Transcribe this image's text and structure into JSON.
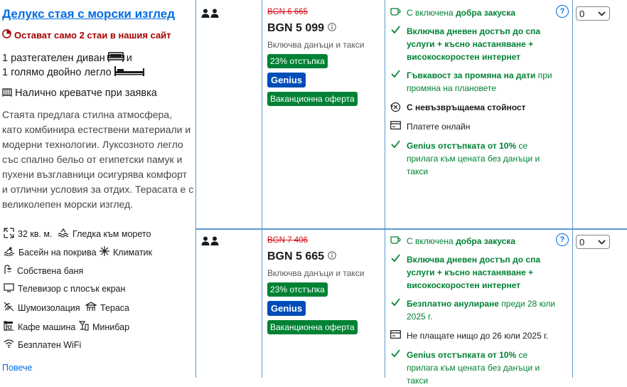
{
  "room": {
    "title": "Делукс стая с морски изглед",
    "scarcity": "Остават само 2 стаи в нашия сайт",
    "beds": [
      {
        "text": "1 разтегателен диван",
        "suffix": "и"
      },
      {
        "text": "1 голямо двойно легло",
        "suffix": ""
      }
    ],
    "crib": "Налично креватче при заявка",
    "description": "Стаята предлага стилна атмосфера, като комбинира естествени материали и модерни технологии. Луксозното легло със спално бельо от египетски памук и пухени възглавници осигурява комфорт и отлични условия за отдих. Терасата е с великолепен морски изглед.",
    "features": {
      "size": "32 кв. м.",
      "sea_view": "Гледка към морето",
      "rooftop_pool": "Басейн на покрива",
      "aircon": "Климатик",
      "bathroom": "Собствена баня",
      "tv": "Телевизор с плосък екран",
      "soundproof": "Шумоизолация",
      "terrace": "Тераса",
      "coffee": "Кафе машина",
      "minibar": "Минибар",
      "wifi": "Безплатен WiFi"
    },
    "more_link": "Повече"
  },
  "offers": [
    {
      "old_price": "BGN 6 665",
      "price": "BGN 5 099",
      "tax_note": "Включва данъци и такси",
      "discount": "23% отстъпка",
      "genius": "Genius",
      "vacation": "Ваканционна оферта",
      "breakfast_prefix": "С включена ",
      "breakfast_bold": "добра закуска",
      "day_access": "Включва дневен достъп до спа услуги + късно настаняване + високоскоростен интернет",
      "flex_bold": "Гъвкавост за промяна на дати",
      "flex_rest": " при промяна на плановете",
      "nonrefund": "С невъзвръщаема стойност",
      "pay": "Платете онлайн",
      "genius_bold": "Genius отстъпката от 10%",
      "genius_rest": " се прилага към цената без данъци и такси",
      "select_value": "0"
    },
    {
      "old_price": "BGN 7 406",
      "price": "BGN 5 665",
      "tax_note": "Включва данъци и такси",
      "discount": "23% отстъпка",
      "genius": "Genius",
      "vacation": "Ваканционна оферта",
      "breakfast_prefix": "С включена ",
      "breakfast_bold": "добра закуска",
      "day_access": "Включва дневен достъп до спа услуги + късно настаняване + високоскоростен интернет",
      "cancel_bold": "Безплатно анулиране",
      "cancel_rest": " преди 28 юли 2025 г.",
      "pay": "Не плащате нищо до 26 юли 2025 г.",
      "genius_bold": "Genius отстъпката от 10%",
      "genius_rest": " се прилага към цената без данъци и такси",
      "select_value": "0"
    }
  ],
  "colors": {
    "link": "#006ce4",
    "green": "#008234",
    "genius": "#004cb8",
    "red": "#d4111e",
    "border": "#5b9bd5"
  }
}
